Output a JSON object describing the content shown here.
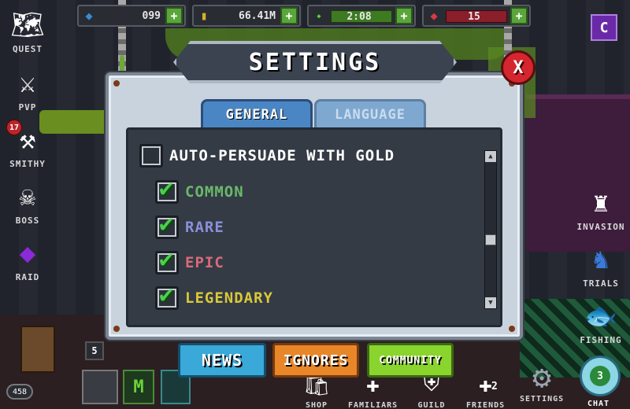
{
  "resources": [
    {
      "name": "gems",
      "icon": "◆",
      "color": "#3a8ad8",
      "value": "099"
    },
    {
      "name": "gold",
      "icon": "▮",
      "color": "#d8b02a",
      "value": "66.41M"
    },
    {
      "name": "energy",
      "icon": "⬩",
      "color": "#5ad43a",
      "value": "2:08"
    },
    {
      "name": "tickets",
      "icon": "◆",
      "color": "#d83a4a",
      "value": "15"
    }
  ],
  "plus_label": "+",
  "corner_label": "C",
  "side_menu": {
    "quest": {
      "label": "QUEST",
      "icon": "🗺"
    },
    "pvp": {
      "label": "PVP",
      "icon": "⚔"
    },
    "smithy": {
      "label": "SMITHY",
      "icon": "⚒",
      "badge": "17"
    },
    "boss": {
      "label": "BOSS",
      "icon": "☠"
    },
    "raid": {
      "label": "RAID",
      "icon": "◆"
    }
  },
  "right_menu": {
    "invasion": {
      "label": "INVASION",
      "icon": "♜"
    },
    "trials": {
      "label": "TRIALS",
      "icon": "♞"
    },
    "fishing": {
      "label": "FISHING",
      "icon": "🐟"
    }
  },
  "bottom_bar": {
    "shop": {
      "label": "SHOP",
      "icon": "🛍"
    },
    "familiars": {
      "label": "FAMILIARS",
      "icon": "✚"
    },
    "guild": {
      "label": "GUILD",
      "icon": "⛨"
    },
    "friends": {
      "label": "FRIENDS",
      "icon": "✚",
      "badge": "2"
    },
    "settings": {
      "label": "SETTINGS",
      "icon": "⚙"
    },
    "chat": {
      "label": "CHAT",
      "badge": "3"
    }
  },
  "player": {
    "level": "458",
    "count": "5"
  },
  "settings_panel": {
    "title": "SETTINGS",
    "close_label": "X",
    "tabs": [
      "GENERAL",
      "LANGUAGE"
    ],
    "active_tab": "GENERAL",
    "options": [
      {
        "label": "AUTO-PERSUADE WITH GOLD",
        "checked": false,
        "color": "#ffffff"
      },
      {
        "label": "COMMON",
        "checked": true,
        "color": "#6ab86a"
      },
      {
        "label": "RARE",
        "checked": true,
        "color": "#8a90d8"
      },
      {
        "label": "EPIC",
        "checked": true,
        "color": "#d86a7a"
      },
      {
        "label": "LEGENDARY",
        "checked": true,
        "color": "#d8c83a"
      }
    ],
    "tick": "✔",
    "scroll_up": "▲",
    "scroll_down": "▼"
  },
  "action_buttons": {
    "news": "NEWS",
    "ignores": "IGNORES",
    "community": "COMMUNITY"
  }
}
